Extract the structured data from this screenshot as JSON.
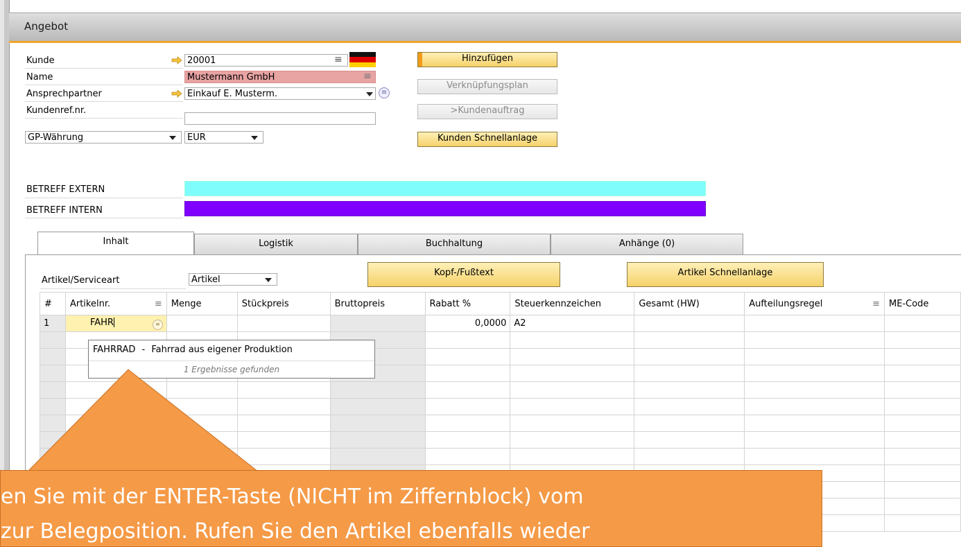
{
  "window": {
    "title": "Angebot"
  },
  "header": {
    "customer_label": "Kunde",
    "customer_value": "20001",
    "name_label": "Name",
    "name_value": "Mustermann GmbH",
    "contact_label": "Ansprechpartner",
    "contact_value": "Einkauf E. Musterm.",
    "custref_label": "Kundenref.nr.",
    "custref_value": "",
    "currency_type_value": "GP-Währung",
    "currency_value": "EUR",
    "subject_ext_label": "BETREFF EXTERN",
    "subject_int_label": "BETREFF INTERN",
    "subject_ext_color": "#7ffdfd",
    "subject_int_color": "#8000ff"
  },
  "buttons": {
    "add": "Hinzufügen",
    "relation_map": "Verknüpfungsplan",
    "to_sales_order": ">Kundenauftrag",
    "quick_customer": "Kunden Schnellanlage"
  },
  "tabs": [
    {
      "label": "Inhalt"
    },
    {
      "label": "Logistik"
    },
    {
      "label": "Buchhaltung"
    },
    {
      "label": "Anhänge (0)"
    }
  ],
  "content": {
    "item_type_label": "Artikel/Serviceart",
    "item_type_value": "Artikel",
    "header_footer_button": "Kopf-/Fußtext",
    "quick_item_button": "Artikel Schnellanlage"
  },
  "grid": {
    "columns": [
      "#",
      "Artikelnr.",
      "Menge",
      "Stückpreis",
      "Bruttopreis",
      "Rabatt %",
      "Steuerkennzeichen",
      "Gesamt (HW)",
      "Aufteilungsregel",
      "ME-Code"
    ],
    "row1": {
      "num": "1",
      "item": "FAHR",
      "discount": "0,0000",
      "tax": "A2"
    }
  },
  "suggestion": {
    "code": "FAHRRAD",
    "separator": "-",
    "description": "Fahrrad aus eigener Produktion",
    "count": "1 Ergebnisse gefunden"
  },
  "callout": {
    "line1": "en Sie mit der ENTER-Taste (NICHT im Ziffernblock) vom",
    "line2": " zur Belegposition. Rufen Sie den Artikel ebenfalls wieder",
    "color": "#f59a47"
  }
}
